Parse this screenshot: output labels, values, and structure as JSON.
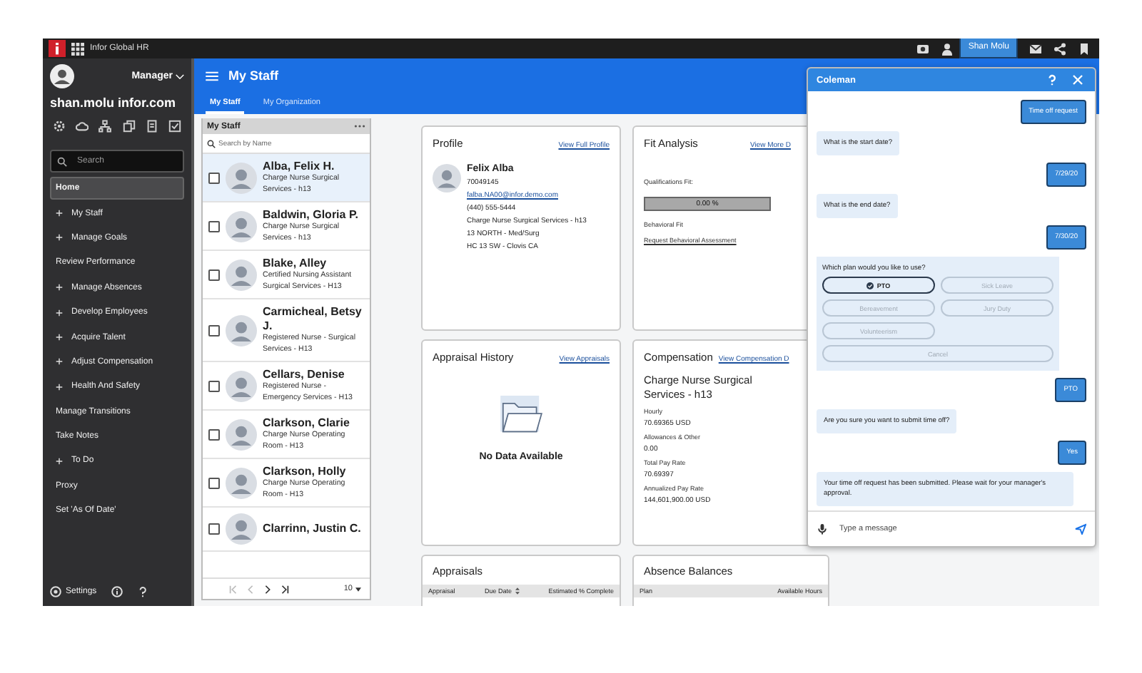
{
  "app_bar": {
    "product": "Infor Global HR",
    "user": "Shan Molu"
  },
  "sidebar": {
    "role": "Manager",
    "email": "shan.molu infor.com",
    "search_placeholder": "Search",
    "items": [
      {
        "label": "Home",
        "expandable": false,
        "selected": true
      },
      {
        "label": "My Staff",
        "expandable": true,
        "selected": false
      },
      {
        "label": "Manage Goals",
        "expandable": true,
        "selected": false
      },
      {
        "label": "Review Performance",
        "expandable": false,
        "selected": false
      },
      {
        "label": "Manage Absences",
        "expandable": true,
        "selected": false
      },
      {
        "label": "Develop Employees",
        "expandable": true,
        "selected": false
      },
      {
        "label": "Acquire Talent",
        "expandable": true,
        "selected": false
      },
      {
        "label": "Adjust Compensation",
        "expandable": true,
        "selected": false
      },
      {
        "label": "Health And Safety",
        "expandable": true,
        "selected": false
      },
      {
        "label": "Manage Transitions",
        "expandable": false,
        "selected": false
      },
      {
        "label": "Take Notes",
        "expandable": false,
        "selected": false
      },
      {
        "label": "To Do",
        "expandable": true,
        "selected": false
      },
      {
        "label": "Proxy",
        "expandable": false,
        "selected": false
      },
      {
        "label": "Set 'As Of Date'",
        "expandable": false,
        "selected": false
      }
    ],
    "settings": "Settings"
  },
  "header": {
    "title": "My Staff",
    "tabs": [
      {
        "label": "My Staff",
        "selected": true
      },
      {
        "label": "My Organization",
        "selected": false
      }
    ]
  },
  "staff_list": {
    "title": "My Staff",
    "search_placeholder": "Search by Name",
    "rows": [
      {
        "name": "Alba, Felix H.",
        "title": "Charge Nurse Surgical Services - h13",
        "selected": true,
        "checked": false
      },
      {
        "name": "Baldwin, Gloria P.",
        "title": "Charge Nurse Surgical Services - h13",
        "selected": false,
        "checked": false
      },
      {
        "name": "Blake, Alley",
        "title": "Certified Nursing Assistant Surgical Services - H13",
        "selected": false,
        "checked": false
      },
      {
        "name": "Carmicheal, Betsy J.",
        "title": "Registered Nurse - Surgical Services - H13",
        "selected": false,
        "checked": false
      },
      {
        "name": "Cellars, Denise",
        "title": "Registered Nurse - Emergency Services - H13",
        "selected": false,
        "checked": false
      },
      {
        "name": "Clarkson, Clarie",
        "title": "Charge Nurse Operating Room - H13",
        "selected": false,
        "checked": false
      },
      {
        "name": "Clarkson, Holly",
        "title": "Charge Nurse Operating Room - H13",
        "selected": false,
        "checked": false
      },
      {
        "name": "Clarrinn, Justin C.",
        "selected": false,
        "checked": false
      }
    ],
    "page_size": "10"
  },
  "profile": {
    "title": "Profile",
    "link": "View Full Profile",
    "name": "Felix Alba",
    "details": [
      "70049145"
    ],
    "email": "falba.NA00@infor.demo.com",
    "more": [
      "(440) 555-5444",
      "Charge Nurse Surgical Services - h13",
      "13 NORTH - Med/Surg",
      "HC 13 SW - Clovis CA"
    ]
  },
  "fit_analysis": {
    "title": "Fit Analysis",
    "link": "View More D",
    "qualifications_label": "Qualifications Fit:",
    "qualifications": {
      "reading": "0.00 %",
      "level": 0
    },
    "behavioral_label": "Behavioral Fit",
    "behavioral_link": "Request Behavioral Assessment"
  },
  "appraisal_history": {
    "title": "Appraisal History",
    "link": "View Appraisals",
    "empty": "No Data Available"
  },
  "compensation": {
    "title": "Compensation",
    "link": "View Compensation D",
    "position": "Charge Nurse Surgical Services - h13",
    "fields": [
      {
        "label": "Hourly",
        "value": "70.69365 USD"
      },
      {
        "label": "Allowances & Other",
        "value": "0.00"
      },
      {
        "label": "Total Pay Rate",
        "value": "70.69397"
      },
      {
        "label": "Annualized Pay Rate",
        "value": "144,601,900.00 USD"
      }
    ]
  },
  "appraisals": {
    "title": "Appraisals",
    "columns": [
      {
        "label": "Appraisal",
        "sortable": false
      },
      {
        "label": "Due Date",
        "sortable": true
      },
      {
        "label": "Estimated % Complete",
        "sortable": false
      }
    ]
  },
  "absence_balances": {
    "title": "Absence Balances",
    "columns": [
      {
        "label": "Plan",
        "sortable": false
      },
      {
        "label": "Available Hours",
        "sortable": false
      }
    ]
  },
  "chat": {
    "title": "Coleman",
    "input_placeholder": "Type a message",
    "messages": [
      {
        "kind": "user",
        "text": "Time off request"
      },
      {
        "kind": "bot",
        "text": "What is the start date?"
      },
      {
        "kind": "user",
        "text": "7/29/20"
      },
      {
        "kind": "bot",
        "text": "What is the end date?"
      },
      {
        "kind": "user",
        "text": "7/30/20"
      },
      {
        "kind": "choices",
        "text": "Which plan would you like to use?",
        "options": [
          {
            "label": "PTO",
            "selected": true,
            "wide": false
          },
          {
            "label": "Sick Leave",
            "selected": false,
            "wide": false
          },
          {
            "label": "Bereavement",
            "selected": false,
            "wide": false
          },
          {
            "label": "Jury Duty",
            "selected": false,
            "wide": false
          },
          {
            "label": "Volunteerism",
            "selected": false,
            "wide": false
          },
          {
            "label": "Cancel",
            "selected": false,
            "wide": true
          }
        ]
      },
      {
        "kind": "user",
        "text": "PTO"
      },
      {
        "kind": "bot",
        "text": "Are you sure you want to submit time off?"
      },
      {
        "kind": "user",
        "text": "Yes"
      },
      {
        "kind": "bot",
        "text": "Your time off request has been submitted. Please wait for your manager's approval."
      }
    ]
  }
}
